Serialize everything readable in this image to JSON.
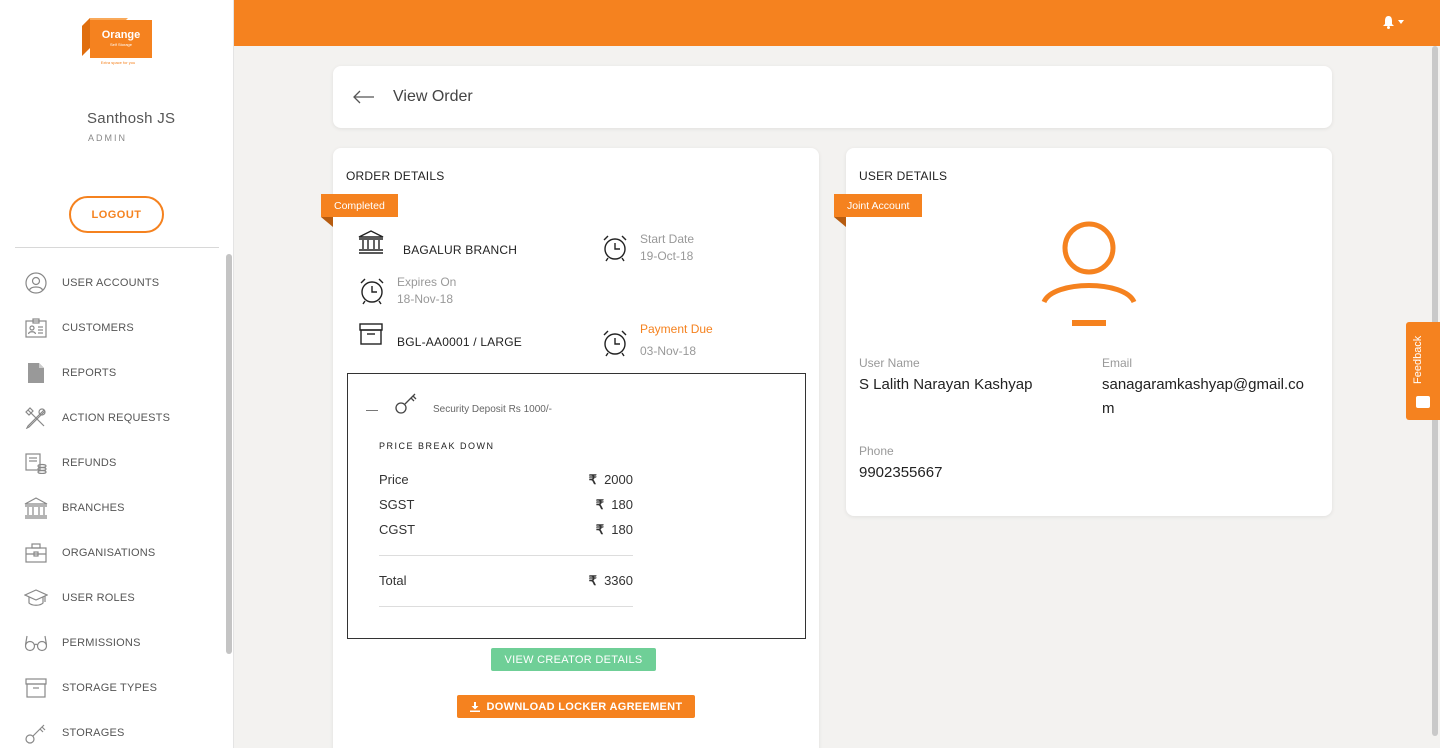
{
  "brand": {
    "logo_text": "Orange",
    "logo_sub": "Self Storage",
    "logo_tagline": "Extra space for you"
  },
  "user": {
    "name": "Santhosh JS",
    "role": "ADMIN",
    "logout_label": "LOGOUT"
  },
  "sidebar": {
    "items": [
      {
        "label": "USER ACCOUNTS",
        "icon": "user-circle-icon"
      },
      {
        "label": "CUSTOMERS",
        "icon": "id-card-icon"
      },
      {
        "label": "REPORTS",
        "icon": "document-icon"
      },
      {
        "label": "ACTION REQUESTS",
        "icon": "tools-icon"
      },
      {
        "label": "REFUNDS",
        "icon": "refund-icon"
      },
      {
        "label": "BRANCHES",
        "icon": "bank-icon"
      },
      {
        "label": "ORGANISATIONS",
        "icon": "briefcase-icon"
      },
      {
        "label": "USER ROLES",
        "icon": "graduation-cap-icon"
      },
      {
        "label": "PERMISSIONS",
        "icon": "glasses-icon"
      },
      {
        "label": "STORAGE TYPES",
        "icon": "archive-box-icon"
      },
      {
        "label": "STORAGES",
        "icon": "key-icon"
      }
    ]
  },
  "header": {
    "title": "View Order"
  },
  "order": {
    "section_title": "ORDER DETAILS",
    "status": "Completed",
    "branch": "BAGALUR  BRANCH",
    "start_date_label": "Start Date",
    "start_date": "19-Oct-18",
    "expires_label": "Expires On",
    "expires_date": "18-Nov-18",
    "locker": "BGL-AA0001 / LARGE",
    "payment_due_label": "Payment Due",
    "payment_due_date": "03-Nov-18",
    "security_deposit": "Security Deposit Rs  1000/-",
    "price_breakdown_title": "PRICE BREAK DOWN",
    "currency_symbol": "₹",
    "rows": [
      {
        "label": "Price",
        "value": "2000"
      },
      {
        "label": "SGST",
        "value": "180"
      },
      {
        "label": "CGST",
        "value": "180"
      }
    ],
    "total_label": "Total",
    "total_value": "3360",
    "view_creator_label": "VIEW CREATOR DETAILS",
    "download_label": "DOWNLOAD LOCKER AGREEMENT"
  },
  "user_details": {
    "section_title": "USER DETAILS",
    "account_type": "Joint Account",
    "username_label": "User Name",
    "username": "S Lalith Narayan Kashyap",
    "email_label": "Email",
    "email_line1": "sanagaramkashyap@gmail.co",
    "email_line2": "m",
    "phone_label": "Phone",
    "phone": "9902355667"
  },
  "feedback_label": "Feedback",
  "colors": {
    "accent": "#f5821f",
    "green": "#6fcf97"
  }
}
